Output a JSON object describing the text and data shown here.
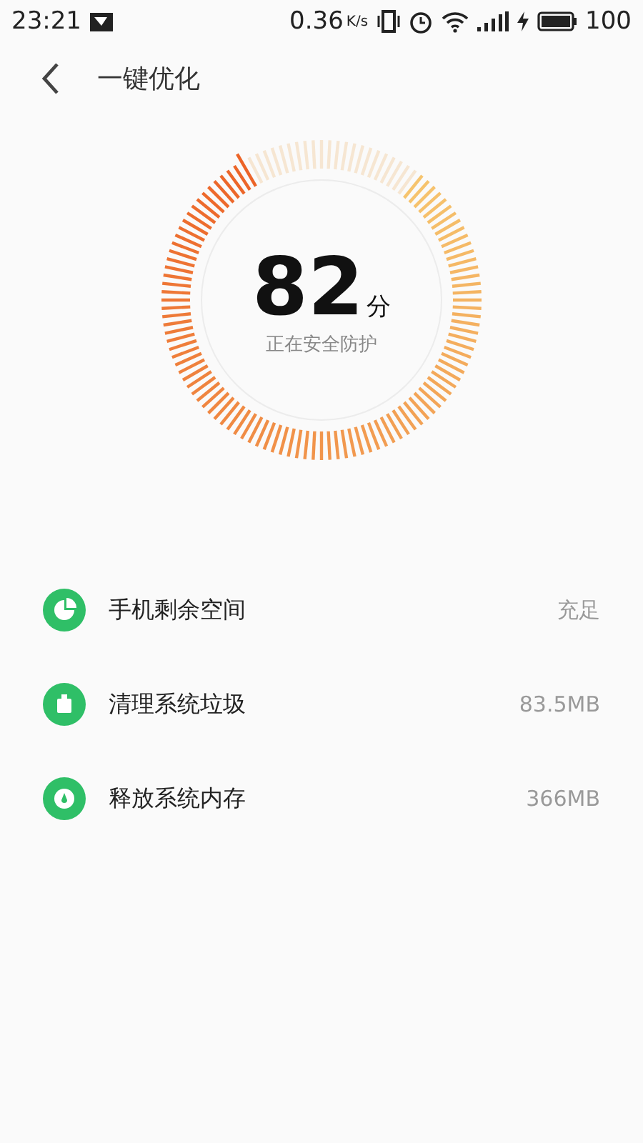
{
  "status_bar": {
    "time": "23:21",
    "speed": "0.36",
    "speed_unit": "K/s",
    "battery": "100"
  },
  "header": {
    "title": "一键优化"
  },
  "gauge": {
    "score": "82",
    "unit": "分",
    "caption": "正在安全防护"
  },
  "items": [
    {
      "kind": "storage",
      "label": "手机剩余空间",
      "value": "充足"
    },
    {
      "kind": "junk",
      "label": "清理系统垃圾",
      "value": "83.5MB"
    },
    {
      "kind": "memory",
      "label": "释放系统内存",
      "value": "366MB"
    }
  ]
}
